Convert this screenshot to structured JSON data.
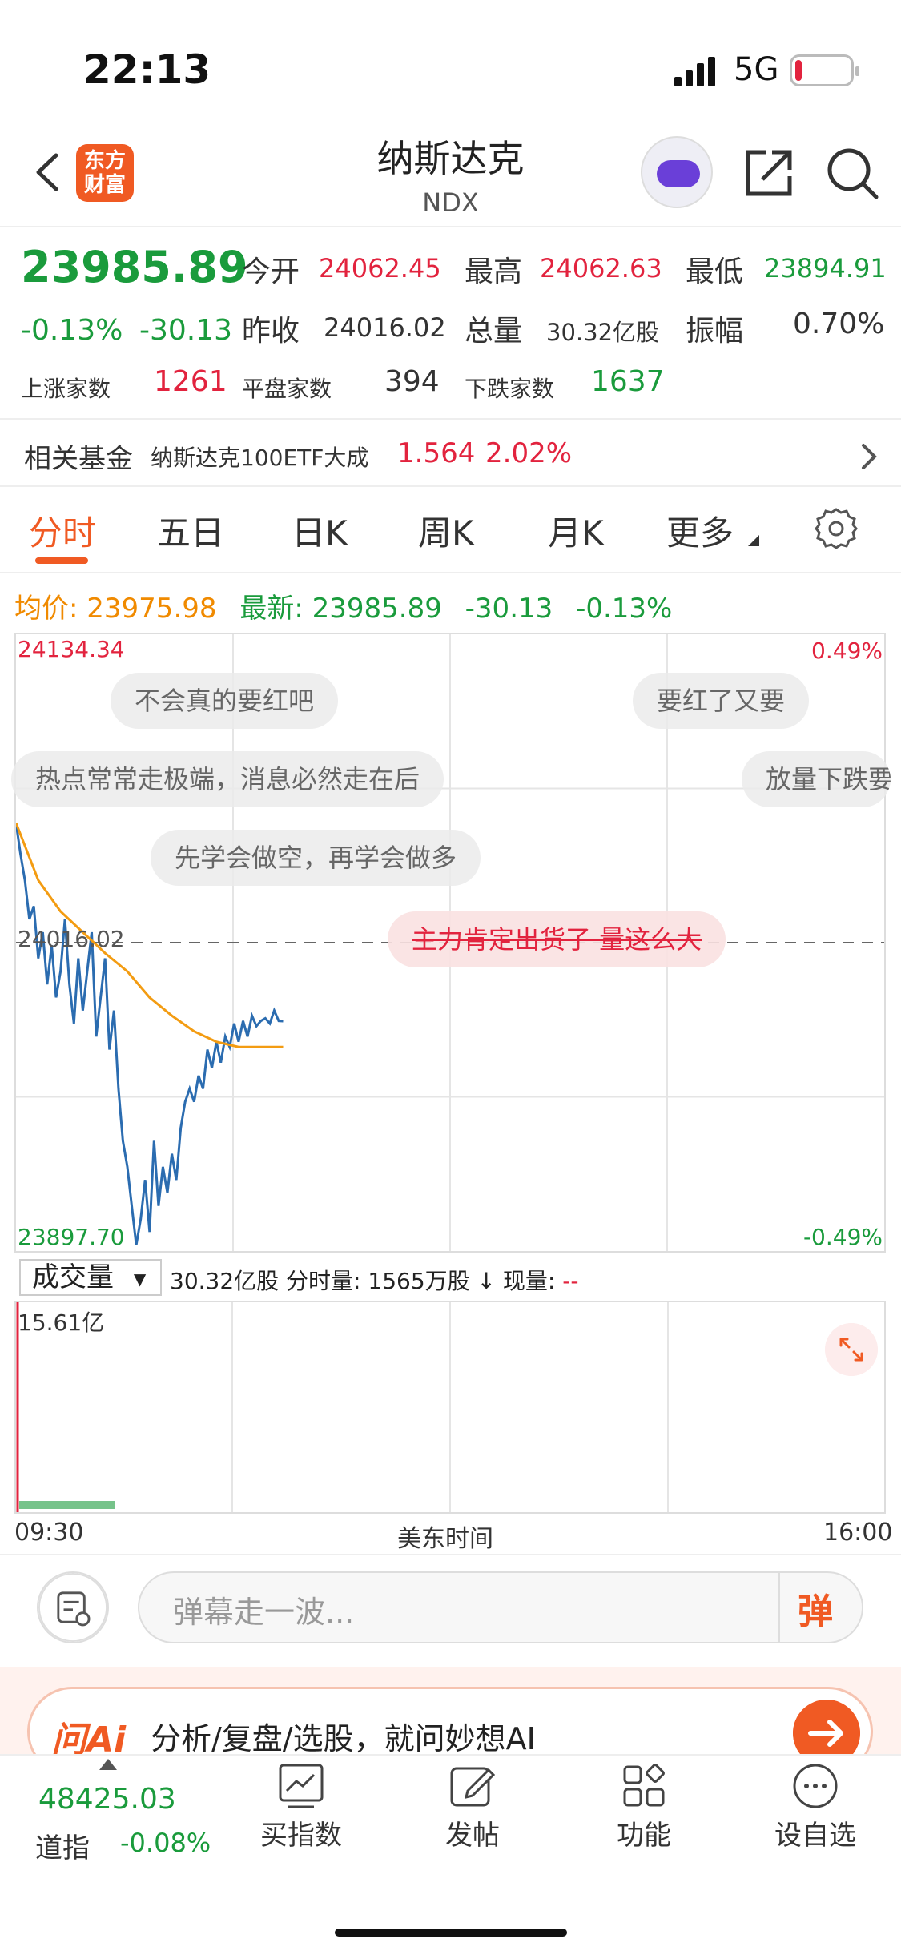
{
  "status_bar": {
    "time": "22:13",
    "network": "5G"
  },
  "header": {
    "logo_text": "东方财富",
    "title": "纳斯达克",
    "subtitle": "NDX"
  },
  "quote": {
    "price": "23985.89",
    "change_pct": "-0.13%",
    "change": "-30.13",
    "stats": [
      {
        "label": "今开",
        "value": "24062.45",
        "color": "red"
      },
      {
        "label": "最高",
        "value": "24062.63",
        "color": "red"
      },
      {
        "label": "最低",
        "value": "23894.91",
        "color": "green"
      },
      {
        "label": "昨收",
        "value": "24016.02",
        "color": "neutral"
      },
      {
        "label": "总量",
        "value": "30.32亿股",
        "color": "neutral"
      },
      {
        "label": "振幅",
        "value": "0.70%",
        "color": "neutral"
      }
    ],
    "breadth": [
      {
        "label": "上涨家数",
        "value": "1261",
        "color": "red"
      },
      {
        "label": "平盘家数",
        "value": "394",
        "color": "neutral"
      },
      {
        "label": "下跌家数",
        "value": "1637",
        "color": "green"
      }
    ]
  },
  "fund": {
    "label": "相关基金",
    "name": "纳斯达克100ETF大成",
    "price": "1.564",
    "pct": "2.02%"
  },
  "tabs": [
    "分时",
    "五日",
    "日K",
    "周K",
    "月K",
    "更多"
  ],
  "avg_row": {
    "avg_label": "均价:",
    "avg_value": "23975.98",
    "latest_label": "最新:",
    "latest_value": "23985.89",
    "chg": "-30.13",
    "pct": "-0.13%"
  },
  "chart_axes": {
    "y_top": "24134.34",
    "y_mid": "24016.02",
    "y_bottom": "23897.70",
    "pct_top": "0.49%",
    "pct_bottom": "-0.49%"
  },
  "danmaku": [
    "不会真的要红吧",
    "要红了又要",
    "热点常常走极端，消息必然走在后",
    "放量下跌要",
    "先学会做空，再学会做多",
    "主力肯定出货了 量这么大"
  ],
  "volume": {
    "dropdown": "成交量",
    "info": "30.32亿股 分时量: 1565万股 ↓ 现量:",
    "now": "--",
    "max_label": "15.61亿"
  },
  "time_axis": {
    "start": "09:30",
    "middle": "美东时间",
    "end": "16:00"
  },
  "comment": {
    "placeholder": "弹幕走一波...",
    "send_label": "弹"
  },
  "ai_banner": {
    "logo": "问Ai",
    "text": "分析/复盘/选股，就问妙想AI"
  },
  "bottom_nav": {
    "index_value": "48425.03",
    "index_name": "道指",
    "index_pct": "-0.08%",
    "items": [
      "买指数",
      "发帖",
      "功能",
      "设自选"
    ]
  },
  "chart_data": {
    "type": "line",
    "title": "",
    "ylim": [
      23897.7,
      24134.34
    ],
    "reference": 24016.02,
    "x_range": [
      "09:30",
      "16:00"
    ],
    "series": [
      {
        "name": "",
        "color": "#2b6cb0",
        "x": [
          0,
          1,
          2,
          3,
          4,
          5,
          6,
          7,
          8,
          9,
          10,
          11,
          12,
          13,
          14,
          15,
          16,
          17,
          18,
          19,
          20,
          21,
          22,
          23,
          24,
          25,
          26,
          27,
          28,
          29,
          30,
          31,
          32,
          33,
          34,
          35,
          36,
          37,
          38,
          39,
          40,
          41,
          42,
          43,
          44,
          45,
          46,
          47,
          48,
          49,
          50,
          51,
          52,
          53,
          54,
          55,
          56,
          57,
          58,
          59,
          60
        ],
        "values": [
          24062,
          24050,
          24040,
          24025,
          24030,
          24010,
          24020,
          24000,
          24015,
          23995,
          24005,
          24025,
          24000,
          23985,
          24010,
          23990,
          24005,
          24020,
          23980,
          23995,
          24010,
          23975,
          23990,
          23960,
          23940,
          23930,
          23915,
          23900,
          23910,
          23925,
          23905,
          23940,
          23915,
          23930,
          23920,
          23935,
          23925,
          23945,
          23955,
          23960,
          23955,
          23965,
          23960,
          23975,
          23968,
          23978,
          23970,
          23980,
          23976,
          23985,
          23978,
          23986,
          23980,
          23988,
          23984,
          23986,
          23987,
          23985,
          23990,
          23986,
          23985.89
        ]
      },
      {
        "name": "",
        "color": "#f39c12",
        "x": [
          0,
          5,
          10,
          15,
          20,
          25,
          30,
          35,
          40,
          45,
          50,
          55,
          60
        ],
        "values": [
          24062,
          24040,
          24028,
          24020,
          24012,
          24005,
          23995,
          23988,
          23982,
          23978,
          23976,
          23976,
          23975.98
        ]
      }
    ]
  },
  "colors": {
    "up": "#e2233e",
    "down": "#1a9b3c",
    "accent": "#f05a23",
    "avg": "#f08a00",
    "line": "#2b6cb0"
  }
}
